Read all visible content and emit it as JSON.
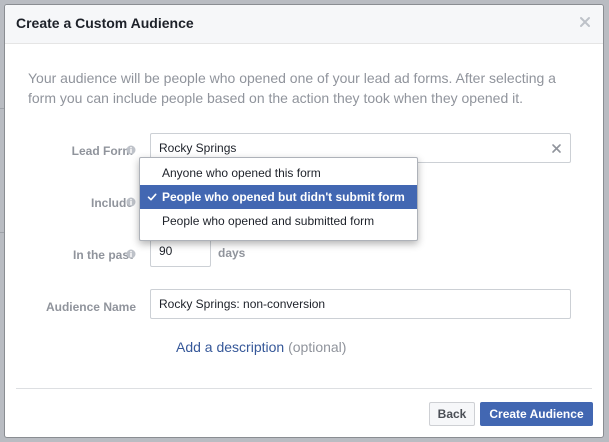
{
  "dialog": {
    "title": "Create a Custom Audience",
    "intro": "Your audience will be people who opened one of your lead ad forms. After selecting a form you can include people based on the action they took when they opened it."
  },
  "form": {
    "lead_form_label": "Lead Form",
    "lead_form_value": "Rocky Springs",
    "include_label": "Include",
    "include_options": [
      "Anyone who opened this form",
      "People who opened but didn't submit form",
      "People who opened and submitted form"
    ],
    "include_selected_index": 1,
    "in_past_label": "In the past",
    "in_past_value": "90",
    "days_label": "days",
    "audience_name_label": "Audience Name",
    "audience_name_value": "Rocky Springs: non-conversion",
    "add_description_link": "Add a description",
    "add_description_optional": "(optional)"
  },
  "buttons": {
    "back": "Back",
    "create": "Create Audience"
  },
  "colors": {
    "primary": "#4267b2",
    "link": "#365899",
    "muted": "#90949c"
  },
  "icons": {
    "close": "close-icon",
    "info": "info-icon",
    "clear": "clear-icon",
    "check": "checkmark-icon"
  }
}
